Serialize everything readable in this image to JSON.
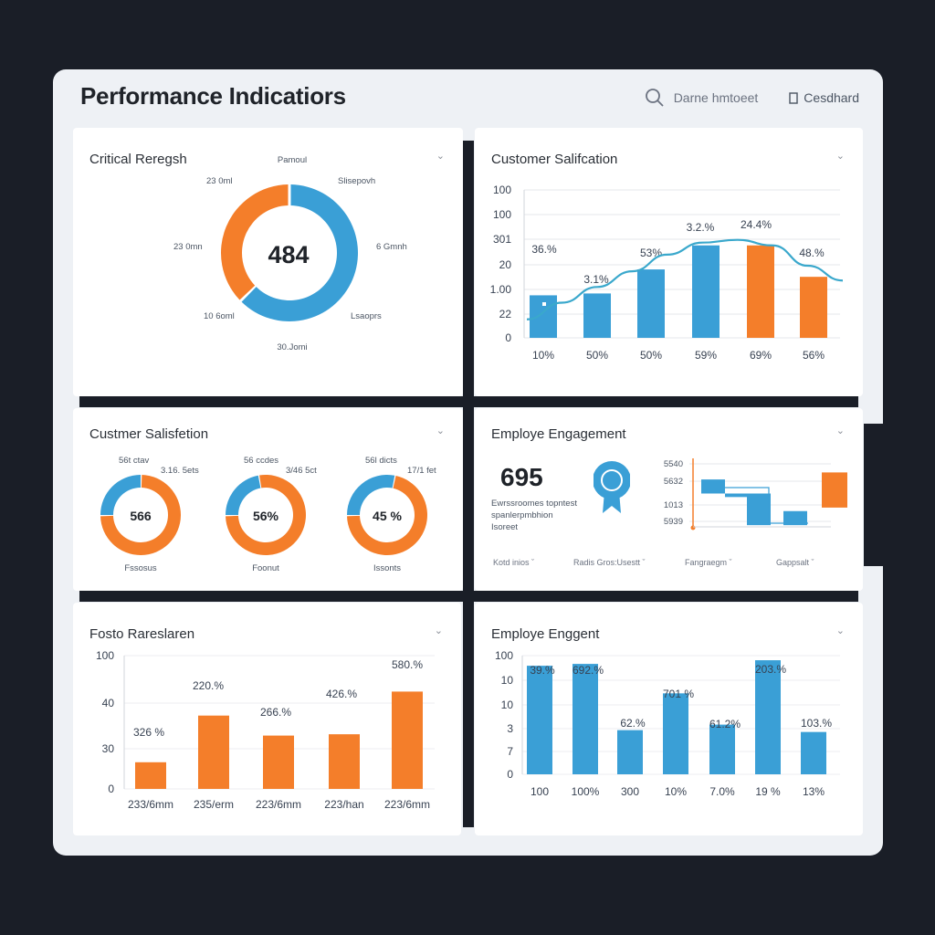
{
  "header": {
    "title": "Performance Indicatiors",
    "search_label": "Darne hmtoeet",
    "dashboard_label": "Cesdhard"
  },
  "colors": {
    "blue": "#3a9fd6",
    "orange": "#f47e2a",
    "line": "#3aa8cc"
  },
  "card1": {
    "title": "Critical Reregsh",
    "center_value": "484",
    "labels": {
      "top": "Pamoul",
      "tr": "Slisepovh",
      "tl": "23 0ml",
      "l": "23 0mn",
      "r": "6 Gmnh",
      "bl": "10 6oml",
      "br": "Lsaoprs",
      "b": "30.Jomi"
    },
    "chart_data": {
      "type": "pie",
      "slices": [
        {
          "color": "#3a9fd6",
          "value": 62
        },
        {
          "color": "#f47e2a",
          "value": 38
        }
      ]
    }
  },
  "card2": {
    "title": "Customer Salifcation",
    "chart_data": {
      "type": "bar",
      "yticks": [
        "100",
        "100",
        "301",
        "20",
        "1.00",
        "22",
        "0"
      ],
      "categories": [
        "10%",
        "50%",
        "50%",
        "59%",
        "69%",
        "56%"
      ],
      "values": [
        46,
        48,
        74,
        100,
        100,
        66
      ],
      "colors": [
        "#3a9fd6",
        "#3a9fd6",
        "#3a9fd6",
        "#3a9fd6",
        "#f47e2a",
        "#f47e2a"
      ],
      "labels": [
        "36.%",
        "3.1%",
        "53%",
        "3.2.%",
        "24.4%",
        "48.%"
      ],
      "line": [
        20,
        38,
        55,
        72,
        90,
        103,
        106,
        100,
        78,
        62
      ],
      "ylim": [
        0,
        160
      ]
    }
  },
  "card3": {
    "title": "Custmer Salisfetion",
    "donuts": [
      {
        "value": "566",
        "top_left": "56t ctav",
        "top_right": "3.16. 5ets",
        "bottom": "Fssosus",
        "chart_data": {
          "type": "pie",
          "slices": [
            {
              "color": "#f47e2a",
              "value": 75
            },
            {
              "color": "#3a9fd6",
              "value": 25
            }
          ]
        }
      },
      {
        "value": "56%",
        "top_left": "56 ccdes",
        "top_right": "3/46 5ct",
        "bottom": "Foonut",
        "chart_data": {
          "type": "pie",
          "slices": [
            {
              "color": "#f47e2a",
              "value": 78
            },
            {
              "color": "#3a9fd6",
              "value": 22
            }
          ]
        }
      },
      {
        "value": "45 %",
        "top_left": "56l dicts",
        "top_right": "17/1 fet",
        "bottom": "Issonts",
        "chart_data": {
          "type": "pie",
          "slices": [
            {
              "color": "#f47e2a",
              "value": 72
            },
            {
              "color": "#3a9fd6",
              "value": 28
            }
          ]
        }
      }
    ]
  },
  "card4": {
    "title": "Employe Engagement",
    "big_value": "695",
    "desc_lines": [
      "Ewrssroomes topntest",
      "spanlerpmbhion",
      "Isoreet"
    ],
    "yticks": [
      "5540",
      "5632",
      "1013",
      "5939"
    ],
    "footers": [
      "Kotd inios",
      "Radis Gros:Usestt",
      "Fangraegm",
      "Gappsalt"
    ],
    "chart_data": {
      "type": "bar",
      "values": [
        {
          "from": 70,
          "to": 50,
          "color": "#3a9fd6"
        },
        {
          "from": 50,
          "to": 45,
          "color": "#3a9fd6"
        },
        {
          "from": 50,
          "to": 5,
          "color": "#3a9fd6"
        },
        {
          "from": 25,
          "to": 5,
          "color": "#3a9fd6"
        },
        {
          "from": 80,
          "to": 30,
          "color": "#f47e2a"
        }
      ]
    }
  },
  "card5": {
    "title": "Fosto Rareslaren",
    "chart_data": {
      "type": "bar",
      "yticks": [
        "100",
        "40",
        "30",
        "0"
      ],
      "categories": [
        "233/6mm",
        "235/erm",
        "223/6mm",
        "223/han",
        "223/6mm"
      ],
      "values": [
        20,
        55,
        40,
        41,
        73
      ],
      "labels": [
        "326 %",
        "220.%",
        "266.%",
        "426.%",
        "580.%"
      ],
      "ylim": [
        0,
        100
      ]
    }
  },
  "card6": {
    "title": "Employe Enggent",
    "chart_data": {
      "type": "bar",
      "yticks": [
        "100",
        "10",
        "10",
        "3",
        "7",
        "0"
      ],
      "categories": [
        "100",
        "100%",
        "300",
        "10%",
        "7.0%",
        "19 %",
        "13%"
      ],
      "values": [
        59,
        60,
        24,
        44,
        27,
        62,
        23
      ],
      "labels": [
        "39.%",
        "692.%",
        "62.%",
        "701 %",
        "61.2%",
        "203.%",
        "103.%"
      ],
      "ylim": [
        0,
        100
      ]
    }
  }
}
